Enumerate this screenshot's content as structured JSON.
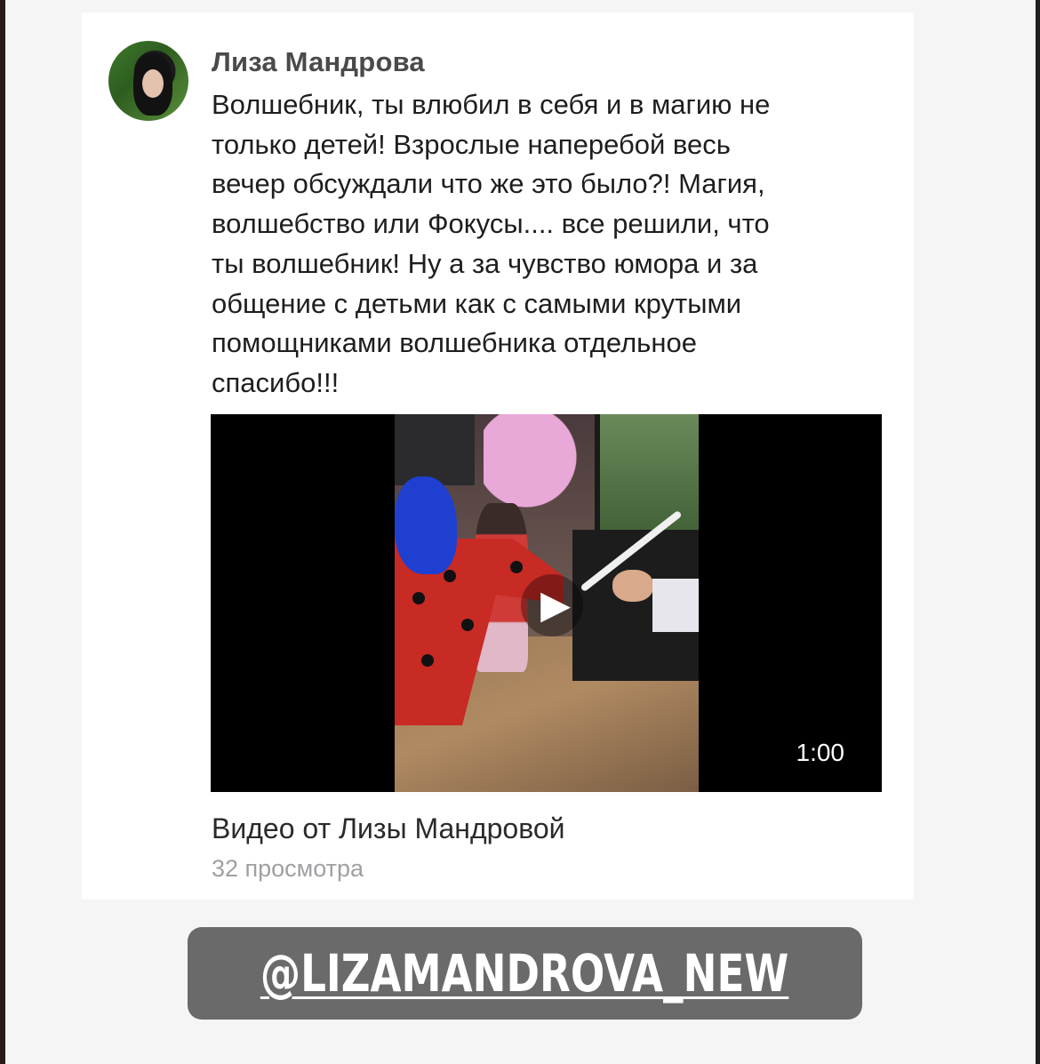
{
  "post": {
    "author_name": "Лиза Мандрова",
    "text": "Волшебник, ты влюбил в себя и в магию не\nтолько детей! Взрослые наперебой весь\nвечер обсуждали что же это было?! Магия,\nволшебство или Фокусы.... все решили, что\nты волшебник! Ну а за чувство юмора и за\nобщение с детьми как с самыми крутыми\nпомощниками волшебника отдельное\nспасибо!!!",
    "video": {
      "duration": "1:00",
      "title": "Видео от Лизы Мандровой",
      "views": "32 просмотра",
      "play_icon": "▶"
    }
  },
  "sticker": {
    "handle": "@LIZAMANDROVA_NEW"
  },
  "colors": {
    "background": "#f5f5f5",
    "card": "#ffffff",
    "author": "#4a4a4a",
    "text": "#1e1e1e",
    "views": "#a0a0a4",
    "sticker": "#6a6a6a"
  }
}
